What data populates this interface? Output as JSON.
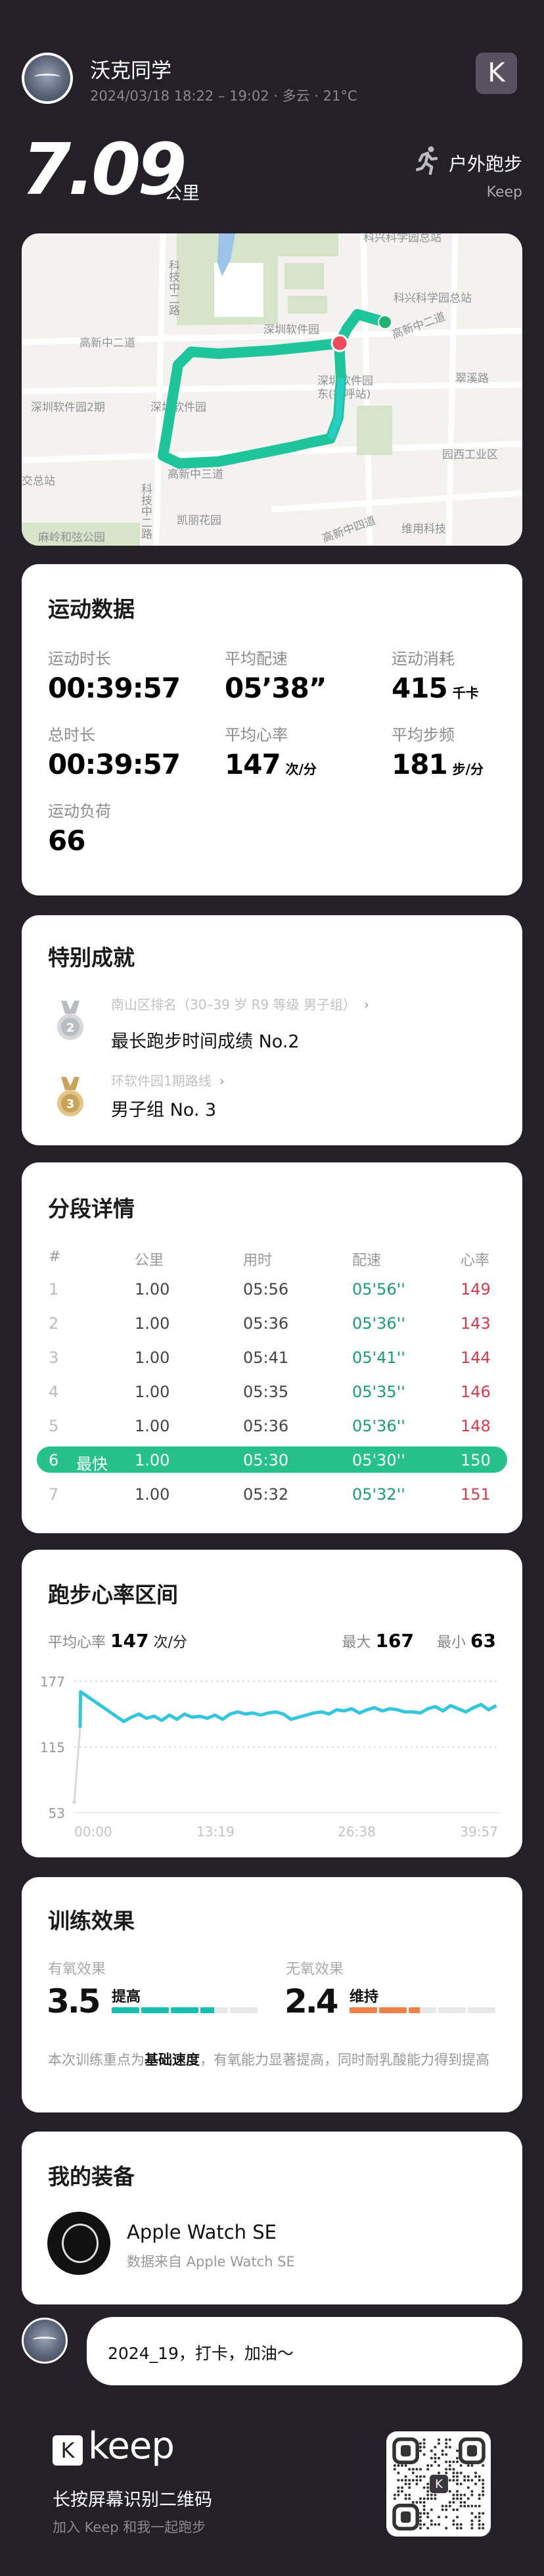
{
  "header": {
    "username": "沃克同学",
    "meta": "2024/03/18 18:22 – 19:02 · 多云 · 21°C",
    "distance": "7.09",
    "distance_unit": "公里",
    "sport_type": "户外跑步",
    "source": "Keep",
    "app_logo_letter": "K"
  },
  "map": {
    "labels": [
      "科兴科学园总站",
      "科兴科学园总站",
      "高新中二道",
      "深圳软件园",
      "深圳软件园2期",
      "深圳软件园",
      "深圳软件园",
      "东(招呼站)",
      "翠溪路",
      "园西工业区",
      "高新中三道",
      "凯丽花园",
      "维用科技",
      "高新中四道",
      "麻岭和弦公园",
      "科技中二路",
      "科技中二路",
      "高新中二道",
      "交总站"
    ],
    "route_color": "#1fc59a",
    "start_color": "#1fb36e",
    "end_color": "#ef4b5a"
  },
  "stats": {
    "title": "运动数据",
    "items": [
      {
        "label": "运动时长",
        "value": "00:39:57",
        "unit": ""
      },
      {
        "label": "平均配速",
        "value": "05’38”",
        "unit": ""
      },
      {
        "label": "运动消耗",
        "value": "415",
        "unit": "千卡"
      },
      {
        "label": "总时长",
        "value": "00:39:57",
        "unit": ""
      },
      {
        "label": "平均心率",
        "value": "147",
        "unit": "次/分"
      },
      {
        "label": "平均步频",
        "value": "181",
        "unit": "步/分"
      },
      {
        "label": "运动负荷",
        "value": "66",
        "unit": ""
      }
    ]
  },
  "achievements": {
    "title": "特别成就",
    "items": [
      {
        "medal": "2",
        "subtitle": "南山区排名（30–39 岁 R9 等级 男子组）",
        "main": "最长跑步时间成绩 No.2"
      },
      {
        "medal": "3",
        "subtitle": "环软件园1期路线",
        "main": "男子组 No. 3"
      }
    ]
  },
  "splits": {
    "title": "分段详情",
    "headers": {
      "num": "#",
      "km": "公里",
      "time": "用时",
      "pace": "配速",
      "hr": "心率"
    },
    "fastest_label": "最快",
    "rows": [
      {
        "num": "1",
        "km": "1.00",
        "time": "05:56",
        "pace": "05'56''",
        "hr": "149",
        "fastest": false
      },
      {
        "num": "2",
        "km": "1.00",
        "time": "05:36",
        "pace": "05'36''",
        "hr": "143",
        "fastest": false
      },
      {
        "num": "3",
        "km": "1.00",
        "time": "05:41",
        "pace": "05'41''",
        "hr": "144",
        "fastest": false
      },
      {
        "num": "4",
        "km": "1.00",
        "time": "05:35",
        "pace": "05'35''",
        "hr": "146",
        "fastest": false
      },
      {
        "num": "5",
        "km": "1.00",
        "time": "05:36",
        "pace": "05'36''",
        "hr": "148",
        "fastest": false
      },
      {
        "num": "6",
        "km": "1.00",
        "time": "05:30",
        "pace": "05'30''",
        "hr": "150",
        "fastest": true
      },
      {
        "num": "7",
        "km": "1.00",
        "time": "05:32",
        "pace": "05'32''",
        "hr": "151",
        "fastest": false
      }
    ]
  },
  "heart_rate": {
    "title": "跑步心率区间",
    "avg_label": "平均心率",
    "avg_value": "147",
    "avg_unit": "次/分",
    "max_label": "最大",
    "max_value": "167",
    "min_label": "最小",
    "min_value": "63"
  },
  "chart_data": {
    "type": "line",
    "title": "跑步心率区间",
    "xlabel": "",
    "ylabel": "",
    "x_ticks": [
      "00:00",
      "13:19",
      "26:38",
      "39:57"
    ],
    "y_ticks": [
      "177",
      "115",
      "53"
    ],
    "xlim_s": [
      0,
      2397
    ],
    "ylim": [
      53,
      177
    ],
    "warmup_series": {
      "t_s": [
        0,
        33
      ],
      "hr": [
        63,
        133
      ],
      "color": "#d9d9d9"
    },
    "series_start": [
      [
        33,
        133
      ],
      [
        36,
        167
      ]
    ],
    "samples_start_s": 280,
    "sample_interval_s": 43,
    "hr_samples": [
      139,
      143,
      146,
      142,
      144,
      140,
      145,
      141,
      146,
      143,
      144,
      142,
      145,
      141,
      146,
      148,
      146,
      147,
      145,
      147,
      148,
      146,
      141,
      143,
      145,
      147,
      148,
      146,
      150,
      149,
      151,
      147,
      150,
      152,
      149,
      151,
      150,
      148,
      148,
      147,
      151,
      153,
      149,
      154,
      151,
      148,
      152,
      155,
      150,
      154
    ],
    "line_color": "#33c6dc",
    "grid": true
  },
  "training": {
    "title": "训练效果",
    "aerobic": {
      "label": "有氧效果",
      "value": "3.5",
      "level": "提高",
      "score": 3.5,
      "max": 5,
      "color": "#17bfae"
    },
    "anaerobic": {
      "label": "无氧效果",
      "value": "2.4",
      "level": "维持",
      "score": 2.4,
      "max": 5,
      "color": "#f08248"
    },
    "desc_pre": "本次训练重点为",
    "desc_bold": "基础速度",
    "desc_post": "，有氧能力显著提高，同时耐乳酸能力得到提高"
  },
  "gear": {
    "title": "我的装备",
    "name": "Apple Watch SE",
    "source": "数据来自 Apple Watch SE"
  },
  "comment": {
    "text": "2024_19，打卡，加油～"
  },
  "footer": {
    "brand": "keep",
    "logo_letter": "K",
    "scan_text": "长按屏幕识别二维码",
    "invite_text": "加入 Keep 和我一起跑步"
  }
}
